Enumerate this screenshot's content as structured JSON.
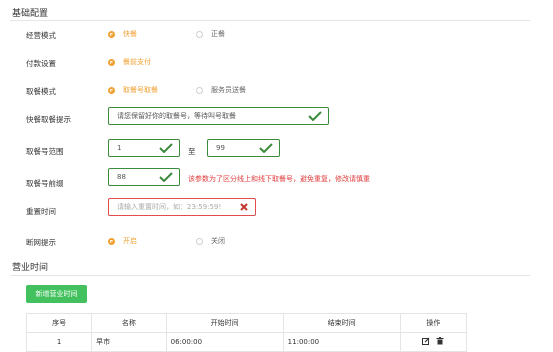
{
  "basic": {
    "title": "基础配置",
    "mode": {
      "label": "经营模式",
      "options": [
        "快餐",
        "正餐"
      ],
      "selected": 0
    },
    "payment": {
      "label": "付款设置",
      "options": [
        "餐前支付"
      ],
      "selected": 0
    },
    "pickup_mode": {
      "label": "取餐模式",
      "options": [
        "取餐号取餐",
        "服务员送餐"
      ],
      "selected": 0
    },
    "pickup_tip": {
      "label": "快餐取餐提示",
      "value": "请您保留好你的取餐号，等待叫号取餐"
    },
    "number_range": {
      "label": "取餐号范围",
      "from": "1",
      "to": "99",
      "separator": "至"
    },
    "prefix": {
      "label": "取餐号前缀",
      "value": "88",
      "hint": "该参数为了区分线上和线下取餐号，避免重复，修改请慎重"
    },
    "reset_time": {
      "label": "重置时间",
      "placeholder": "请输入重置时间，如：23:59:59!"
    },
    "offline": {
      "label": "断网提示",
      "options": [
        "开启",
        "关闭"
      ],
      "selected": 0
    }
  },
  "hours": {
    "title": "营业时间",
    "add_button": "新增营业时间",
    "columns": [
      "序号",
      "名称",
      "开始时间",
      "结束时间",
      "操作"
    ],
    "rows": [
      {
        "index": "1",
        "name": "早市",
        "start": "06:00:00",
        "end": "11:00:00"
      }
    ]
  },
  "colors": {
    "accent": "#f0a030",
    "success": "#3c8a3c",
    "danger": "#e03b3b",
    "button": "#43c15e"
  }
}
